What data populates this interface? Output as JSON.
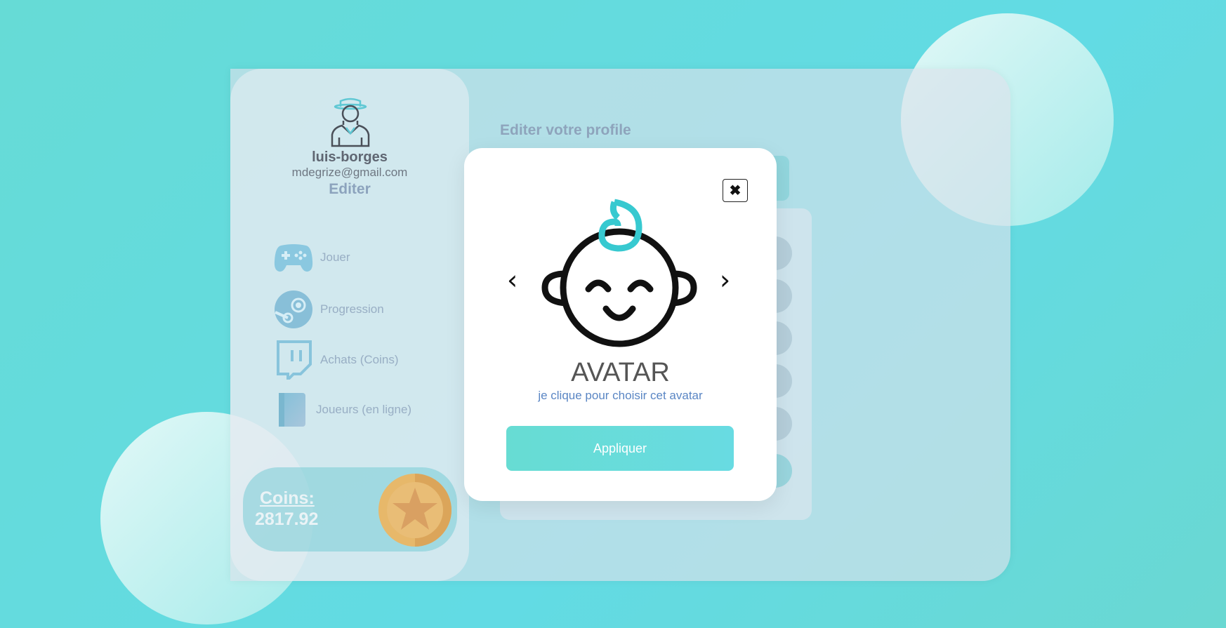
{
  "profile": {
    "username": "luis-borges",
    "email": "mdegrize@gmail.com",
    "edit_label": "Editer"
  },
  "nav": {
    "items": [
      {
        "label": "Jouer",
        "icon": "gamepad-icon"
      },
      {
        "label": "Progression",
        "icon": "steam-icon"
      },
      {
        "label": "Achats (Coins)",
        "icon": "twitch-icon"
      },
      {
        "label": "Joueurs (en ligne)",
        "icon": "book-icon"
      }
    ]
  },
  "coins": {
    "label": "Coins:",
    "value": "2817.92"
  },
  "main": {
    "title": "Editer votre profile"
  },
  "modal": {
    "close_icon": "close-icon",
    "prev_glyph": "‹",
    "next_glyph": "›",
    "avatar_title": "AVATAR",
    "hint": "je clique pour choisir cet avatar",
    "apply_label": "Appliquer"
  },
  "colors": {
    "accent": "#67dcd3",
    "background": "#66dbd6",
    "hint_text": "#5a86c4"
  }
}
